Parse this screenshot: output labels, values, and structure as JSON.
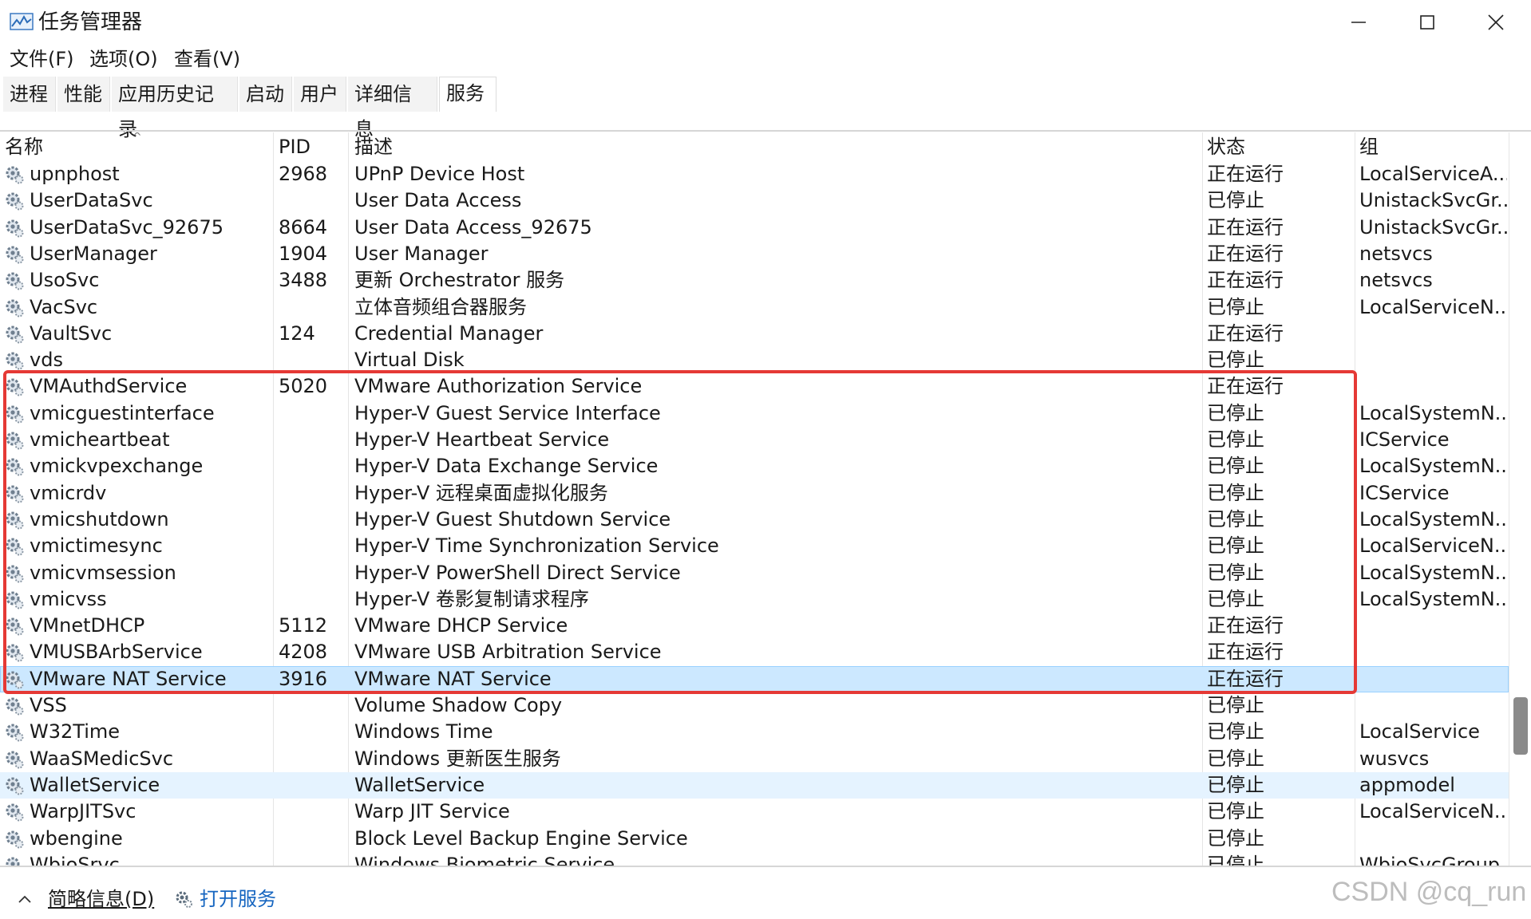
{
  "window": {
    "title": "任务管理器",
    "controls": {
      "minimize": "minimize-icon",
      "maximize": "maximize-icon",
      "close": "close-icon"
    }
  },
  "menu": [
    {
      "label": "文件(F)"
    },
    {
      "label": "选项(O)"
    },
    {
      "label": "查看(V)"
    }
  ],
  "tabs": [
    {
      "label": "进程"
    },
    {
      "label": "性能"
    },
    {
      "label": "应用历史记录"
    },
    {
      "label": "启动"
    },
    {
      "label": "用户"
    },
    {
      "label": "详细信息"
    },
    {
      "label": "服务",
      "active": true
    }
  ],
  "columns": {
    "name": "名称",
    "pid": "PID",
    "desc": "描述",
    "status": "状态",
    "group": "组"
  },
  "rows": [
    {
      "name": "upnphost",
      "pid": "2968",
      "desc": "UPnP Device Host",
      "status": "正在运行",
      "group": "LocalServiceA..."
    },
    {
      "name": "UserDataSvc",
      "pid": "",
      "desc": "User Data Access",
      "status": "已停止",
      "group": "UnistackSvcGr..."
    },
    {
      "name": "UserDataSvc_92675",
      "pid": "8664",
      "desc": "User Data Access_92675",
      "status": "正在运行",
      "group": "UnistackSvcGr..."
    },
    {
      "name": "UserManager",
      "pid": "1904",
      "desc": "User Manager",
      "status": "正在运行",
      "group": "netsvcs"
    },
    {
      "name": "UsoSvc",
      "pid": "3488",
      "desc": "更新 Orchestrator 服务",
      "status": "正在运行",
      "group": "netsvcs"
    },
    {
      "name": "VacSvc",
      "pid": "",
      "desc": "立体音频组合器服务",
      "status": "已停止",
      "group": "LocalServiceN..."
    },
    {
      "name": "VaultSvc",
      "pid": "124",
      "desc": "Credential Manager",
      "status": "正在运行",
      "group": ""
    },
    {
      "name": "vds",
      "pid": "",
      "desc": "Virtual Disk",
      "status": "已停止",
      "group": ""
    },
    {
      "name": "VMAuthdService",
      "pid": "5020",
      "desc": "VMware Authorization Service",
      "status": "正在运行",
      "group": ""
    },
    {
      "name": "vmicguestinterface",
      "pid": "",
      "desc": "Hyper-V Guest Service Interface",
      "status": "已停止",
      "group": "LocalSystemN..."
    },
    {
      "name": "vmicheartbeat",
      "pid": "",
      "desc": "Hyper-V Heartbeat Service",
      "status": "已停止",
      "group": "ICService"
    },
    {
      "name": "vmickvpexchange",
      "pid": "",
      "desc": "Hyper-V Data Exchange Service",
      "status": "已停止",
      "group": "LocalSystemN..."
    },
    {
      "name": "vmicrdv",
      "pid": "",
      "desc": "Hyper-V 远程桌面虚拟化服务",
      "status": "已停止",
      "group": "ICService"
    },
    {
      "name": "vmicshutdown",
      "pid": "",
      "desc": "Hyper-V Guest Shutdown Service",
      "status": "已停止",
      "group": "LocalSystemN..."
    },
    {
      "name": "vmictimesync",
      "pid": "",
      "desc": "Hyper-V Time Synchronization Service",
      "status": "已停止",
      "group": "LocalServiceN..."
    },
    {
      "name": "vmicvmsession",
      "pid": "",
      "desc": "Hyper-V PowerShell Direct Service",
      "status": "已停止",
      "group": "LocalSystemN..."
    },
    {
      "name": "vmicvss",
      "pid": "",
      "desc": "Hyper-V 卷影复制请求程序",
      "status": "已停止",
      "group": "LocalSystemN..."
    },
    {
      "name": "VMnetDHCP",
      "pid": "5112",
      "desc": "VMware DHCP Service",
      "status": "正在运行",
      "group": ""
    },
    {
      "name": "VMUSBArbService",
      "pid": "4208",
      "desc": "VMware USB Arbitration Service",
      "status": "正在运行",
      "group": ""
    },
    {
      "name": "VMware NAT Service",
      "pid": "3916",
      "desc": "VMware NAT Service",
      "status": "正在运行",
      "group": "",
      "state": "selected"
    },
    {
      "name": "VSS",
      "pid": "",
      "desc": "Volume Shadow Copy",
      "status": "已停止",
      "group": ""
    },
    {
      "name": "W32Time",
      "pid": "",
      "desc": "Windows Time",
      "status": "已停止",
      "group": "LocalService"
    },
    {
      "name": "WaaSMedicSvc",
      "pid": "",
      "desc": "Windows 更新医生服务",
      "status": "已停止",
      "group": "wusvcs"
    },
    {
      "name": "WalletService",
      "pid": "",
      "desc": "WalletService",
      "status": "已停止",
      "group": "appmodel",
      "state": "hover"
    },
    {
      "name": "WarpJITSvc",
      "pid": "",
      "desc": "Warp JIT Service",
      "status": "已停止",
      "group": "LocalServiceN..."
    },
    {
      "name": "wbengine",
      "pid": "",
      "desc": "Block Level Backup Engine Service",
      "status": "已停止",
      "group": ""
    },
    {
      "name": "WbioSrvc",
      "pid": "",
      "desc": "Windows Biometric Service",
      "status": "已停止",
      "group": "WbioSvcGroup"
    }
  ],
  "footer": {
    "fewer_details": "简略信息(D)",
    "open_services": "打开服务"
  },
  "watermark": "CSDN @cq_run",
  "colors": {
    "selected_row": "#cce8ff",
    "hover_row": "#e5f3ff",
    "highlight_box": "#e53935",
    "link": "#1565c0"
  }
}
